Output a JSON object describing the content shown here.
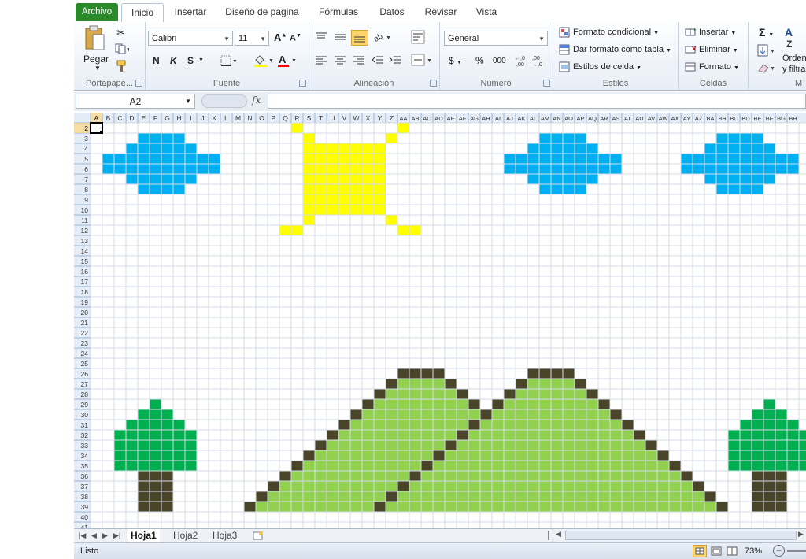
{
  "tabs": {
    "file": "Archivo",
    "items": [
      "Inicio",
      "Insertar",
      "Diseño de página",
      "Fórmulas",
      "Datos",
      "Revisar",
      "Vista"
    ]
  },
  "ribbon": {
    "clipboard": {
      "paste": "Pegar",
      "label": "Portapape..."
    },
    "font": {
      "name": "Calibri",
      "size": "11",
      "bold": "N",
      "italic": "K",
      "underline": "S",
      "label": "Fuente"
    },
    "alignment": {
      "label": "Alineación"
    },
    "number": {
      "format": "General",
      "label": "Número",
      "percent": "%",
      "thousands": "000"
    },
    "styles": {
      "conditional": "Formato condicional",
      "table": "Dar formato como tabla",
      "cell": "Estilos de celda",
      "label": "Estilos"
    },
    "cells": {
      "insert": "Insertar",
      "delete": "Eliminar",
      "format": "Formato",
      "label": "Celdas"
    },
    "editing": {
      "sort": "Ordenar",
      "filter": "y filtrar",
      "label": "M"
    }
  },
  "formula_bar": {
    "name_box": "A2",
    "fx": "fx",
    "value": ""
  },
  "grid": {
    "columns": [
      "A",
      "B",
      "C",
      "D",
      "E",
      "F",
      "G",
      "H",
      "I",
      "J",
      "K",
      "L",
      "M",
      "N",
      "O",
      "P",
      "Q",
      "R",
      "S",
      "T",
      "U",
      "V",
      "W",
      "X",
      "Y",
      "Z",
      "AA",
      "AB",
      "AC",
      "AD",
      "AE",
      "AF",
      "AG",
      "AH",
      "AI",
      "AJ",
      "AK",
      "AL",
      "AM",
      "AN",
      "AO",
      "AP",
      "AQ",
      "AR",
      "AS",
      "AT",
      "AU",
      "AV",
      "AW",
      "AX",
      "AY",
      "AZ",
      "BA",
      "BB",
      "BC",
      "BD",
      "BE",
      "BF",
      "BG",
      "BH"
    ],
    "rows": [
      "2",
      "3",
      "4",
      "5",
      "6",
      "7",
      "8",
      "9",
      "10",
      "11",
      "12",
      "13",
      "14",
      "15",
      "16",
      "17",
      "18",
      "19",
      "20",
      "21",
      "22",
      "23",
      "24",
      "25",
      "26",
      "27",
      "28",
      "29",
      "30",
      "31",
      "32",
      "33",
      "34",
      "35",
      "36",
      "37",
      "38",
      "39",
      "40",
      "41"
    ],
    "active_cell": "A2",
    "colors": {
      "cloud": "#00b0f0",
      "sun": "#ffff00",
      "hill": "#92d050",
      "outline": "#4a4429",
      "leaf": "#00b050",
      "trunk": "#4a4429"
    }
  },
  "sheets": {
    "tabs": [
      "Hoja1",
      "Hoja2",
      "Hoja3"
    ],
    "active": "Hoja1"
  },
  "status": {
    "ready": "Listo",
    "zoom": "73%"
  }
}
